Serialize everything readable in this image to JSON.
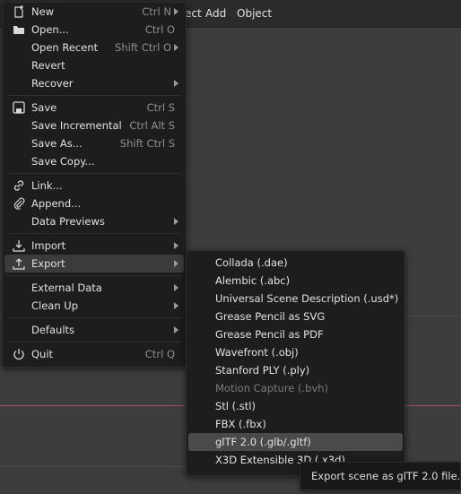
{
  "topbar": {
    "menus": [
      "ect",
      "Add",
      "Object"
    ]
  },
  "file_menu": {
    "items": [
      {
        "label": "New",
        "shortcut": "Ctrl N",
        "icon": "new-file-icon",
        "submenu": true
      },
      {
        "label": "Open...",
        "shortcut": "Ctrl O",
        "icon": "folder-icon"
      },
      {
        "label": "Open Recent",
        "shortcut": "Shift Ctrl O",
        "submenu": true
      },
      {
        "label": "Revert"
      },
      {
        "label": "Recover",
        "submenu": true
      },
      {
        "label": "Save",
        "shortcut": "Ctrl S",
        "icon": "save-icon"
      },
      {
        "label": "Save Incremental",
        "shortcut": "Ctrl Alt S"
      },
      {
        "label": "Save As...",
        "shortcut": "Shift Ctrl S"
      },
      {
        "label": "Save Copy..."
      },
      {
        "label": "Link...",
        "icon": "link-icon"
      },
      {
        "label": "Append...",
        "icon": "paperclip-icon"
      },
      {
        "label": "Data Previews",
        "submenu": true
      },
      {
        "label": "Import",
        "icon": "import-icon",
        "submenu": true
      },
      {
        "label": "Export",
        "icon": "export-icon",
        "submenu": true,
        "active": true
      },
      {
        "label": "External Data",
        "submenu": true
      },
      {
        "label": "Clean Up",
        "submenu": true
      },
      {
        "label": "Defaults",
        "submenu": true
      },
      {
        "label": "Quit",
        "shortcut": "Ctrl Q",
        "icon": "power-icon"
      }
    ]
  },
  "export_menu": {
    "items": [
      {
        "label": "Collada (.dae)"
      },
      {
        "label": "Alembic (.abc)"
      },
      {
        "label": "Universal Scene Description (.usd*)"
      },
      {
        "label": "Grease Pencil as SVG"
      },
      {
        "label": "Grease Pencil as PDF"
      },
      {
        "label": "Wavefront (.obj)"
      },
      {
        "label": "Stanford PLY (.ply)"
      },
      {
        "label": "Motion Capture (.bvh)",
        "disabled": true
      },
      {
        "label": "Stl (.stl)"
      },
      {
        "label": "FBX (.fbx)"
      },
      {
        "label": "glTF 2.0 (.glb/.gltf)",
        "active": true
      },
      {
        "label": "X3D Extensible 3D (.x3d)"
      }
    ]
  },
  "tooltip": {
    "text": "Export scene as glTF 2.0 file."
  },
  "colors": {
    "menu_bg": "#1d1d1d",
    "hover": "#3b3b3b",
    "axis_red": "#a84d57"
  }
}
